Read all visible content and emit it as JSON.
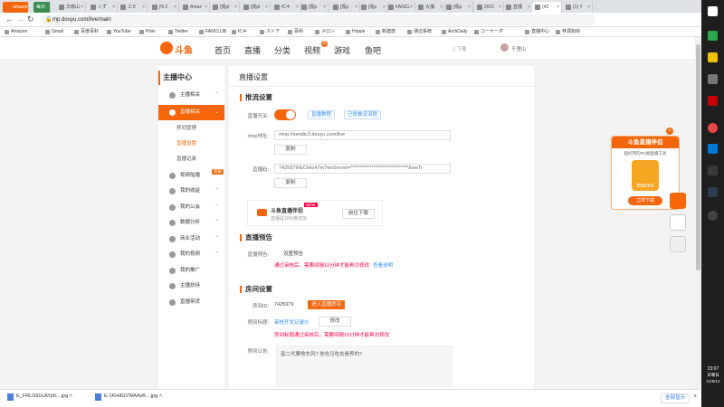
{
  "browser": {
    "tabs": [
      "amazon",
      "每日",
      "华南山",
      "くず",
      "エビ",
      "[N 2",
      "Amaz",
      "[观pl",
      "[观pl",
      "ICキ",
      "[观p",
      "[观p",
      "[观p",
      "FANCL",
      "大播",
      "[观p",
      "2021",
      "直播",
      "(42",
      "(1) Y",
      "直播"
    ],
    "url": "mp.douyu.com/live/main",
    "bookmarks": [
      "Amazon",
      "Gmail",
      "百度百科",
      "YouTube",
      "Pixiv",
      "Twitter",
      "FANCLUB",
      "ICキ",
      "ストア",
      "百科",
      "メロン",
      "Hoppii",
      "新建放",
      "通过系统",
      "ArchDaily",
      "コーナーダ",
      "直播中心",
      "林调如尚"
    ]
  },
  "site": {
    "logo": "斗鱼",
    "nav": [
      "首页",
      "直播",
      "分类",
      "视频",
      "游戏",
      "鱼吧"
    ],
    "nav_badge": "8",
    "download": "下载",
    "user": "千里山"
  },
  "sidebar": {
    "title": "主播中心",
    "items": [
      "主播相关",
      "直播相关",
      "视频船播",
      "我的收益",
      "我的公会",
      "数据分析",
      "商业活动",
      "我的视频",
      "我的推广",
      "主播扶持",
      "直播带货"
    ],
    "submenu": [
      "房间管理",
      "直播设置",
      "直播记录"
    ],
    "badge": "新版"
  },
  "main": {
    "page_title": "直播设置",
    "stream": {
      "title": "推流设置",
      "switch_label": "直播开关:",
      "tutorial": "直播教程",
      "docs": "已修推流流程",
      "rtmp_label": "rtmp地址:",
      "rtmp_value": "rtmp://sendtc3.douyu.com/live",
      "copy": "复制",
      "code_label": "直播码:",
      "code_value": "7425979rECkko47m?wsSecret=******************************&wsTi",
      "copy2": "复制",
      "promo_name": "斗鱼直播伴侣",
      "promo_sub": "直播是10%推流加",
      "promo_new": "NEW",
      "promo_btn": "前往下载"
    },
    "notice": {
      "title": "直播预告",
      "label": "直播预告:",
      "btn": "设置预告",
      "warn": "通过审核后，需要间隔10分钟才能再次修改",
      "link": "查看说明"
    },
    "room": {
      "title": "房间设置",
      "id_label": "房间ID:",
      "id_value": "7425979",
      "enter": "进入直播房间",
      "title_label": "房间标题:",
      "title_value": "审核开发记录仪",
      "edit": "修改",
      "warn": "房间标题通过审核后，需要间隔10分钟才能再次修改",
      "ann_label": "房间公告:",
      "ann_value": "富二代要啥东风? 他也马吃去是养的?"
    }
  },
  "ad": {
    "title": "斗鱼直播伴侣",
    "body": "超好用的PC端直播工具",
    "brand": "DOUYU",
    "btn": "立即下载"
  },
  "downloads": {
    "files": [
      "E_FRLOdUcAYp0....jpg",
      "E-1KHdGVWAAyB....jpg"
    ],
    "show_all": "全部显示"
  },
  "taskbar": {
    "time": "23:07",
    "day": "日曜日",
    "date": "21/9/12"
  },
  "colors": {
    "accent": "#f5650a",
    "link": "#2d8cf0",
    "warn": "#ff0044"
  }
}
